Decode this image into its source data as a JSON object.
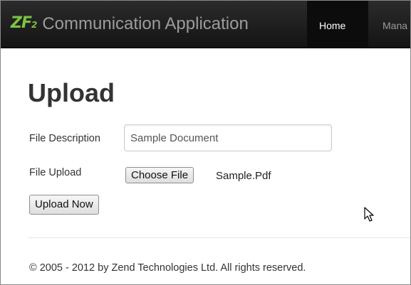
{
  "navbar": {
    "logo_text": "ZF",
    "logo_sub": "2",
    "brand_title": "Communication Application",
    "links": [
      "Home",
      "Mana"
    ],
    "active": "Home"
  },
  "main": {
    "title": "Upload",
    "form": {
      "description_label": "File Description",
      "description_value": "Sample Document",
      "upload_label": "File Upload",
      "choose_button": "Choose File",
      "chosen_file": "Sample.Pdf",
      "submit_button": "Upload Now"
    }
  },
  "footer": {
    "text": "© 2005 - 2012 by Zend Technologies Ltd. All rights reserved."
  },
  "icons": [
    "zf-logo-icon",
    "mouse-pointer-icon"
  ],
  "colors": {
    "navbar_bg": "#1b1b1b",
    "logo_green": "#7dc242",
    "text": "#333333"
  }
}
